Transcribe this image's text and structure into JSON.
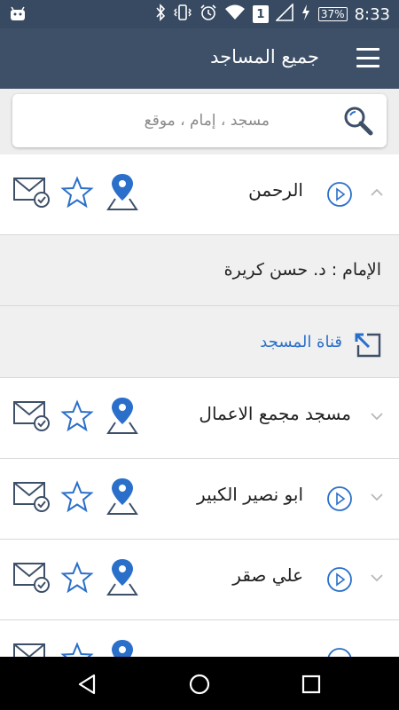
{
  "status_bar": {
    "time": "8:33",
    "battery_percent": "37%",
    "sim_number": "1",
    "icons": [
      "android-icon",
      "bluetooth-icon",
      "vibrate-icon",
      "alarm-icon",
      "wifi-icon",
      "signal-icon",
      "charging-icon"
    ]
  },
  "app_bar": {
    "title": "جميع المساجد",
    "menu_icon": "hamburger-menu-icon"
  },
  "search": {
    "placeholder": "مسجد ، إمام ، موقع",
    "value": ""
  },
  "mosques": [
    {
      "name": "الرحمن",
      "has_play": true,
      "expanded": true,
      "chevron": "chevron-up-icon"
    },
    {
      "name": "مسجد مجمع الاعمال",
      "has_play": false,
      "expanded": false,
      "chevron": "chevron-down-icon"
    },
    {
      "name": "ابو نصير الكبير",
      "has_play": true,
      "expanded": false,
      "chevron": "chevron-down-icon"
    },
    {
      "name": "علي صقر",
      "has_play": true,
      "expanded": false,
      "chevron": "chevron-down-icon"
    }
  ],
  "expanded_details": {
    "imam_text": "الإمام :  د. حسن كريرة",
    "channel_label": "قناة المسجد"
  },
  "colors": {
    "status_bar": "#374a61",
    "app_bar": "#3d5068",
    "icon_blue": "#2a6fc9",
    "link_blue": "#2a6fc9"
  },
  "nav_bar": {
    "buttons": [
      "back-icon",
      "home-icon",
      "recents-icon"
    ]
  }
}
